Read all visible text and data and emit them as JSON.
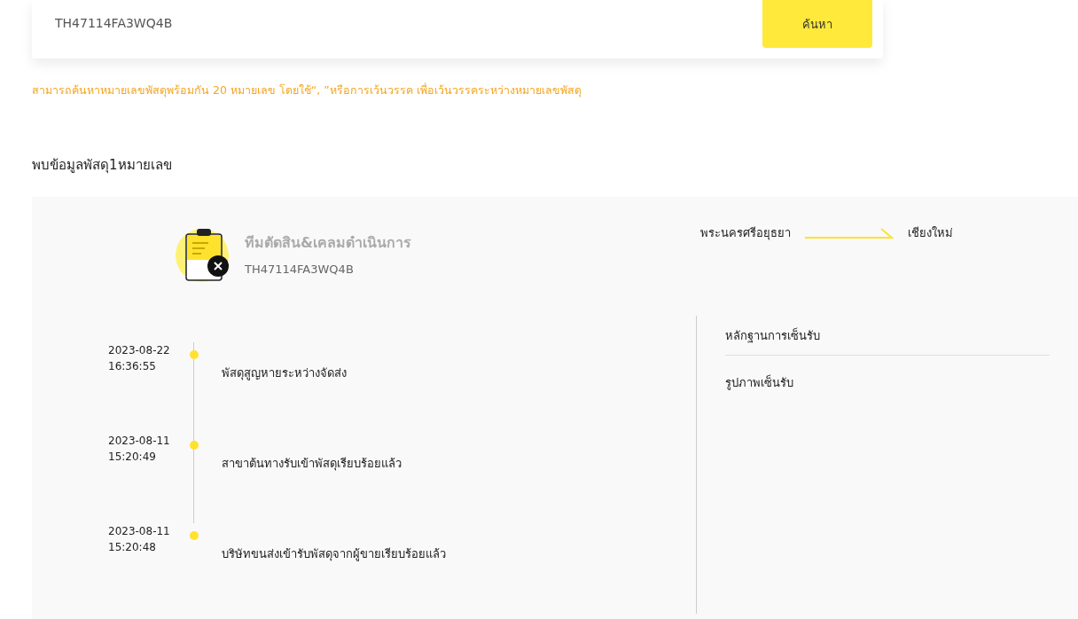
{
  "search": {
    "value": "TH47114FA3WQ4B",
    "button": "ค้นหา"
  },
  "hint": "สามารถค้นหาหมายเลขพัสดุพร้อมกัน 20 หมายเลข โดยใช้“, ”หรือการเว้นวรรค เพื่อเว้นวรรคระหว่างหมายเลขพัสดุ",
  "result_heading": "พบข้อมูลพัสดุ1หมายเลข",
  "parcel": {
    "status": "ทีมตัดสิน&เคลมดำเนินการ",
    "tracking_number": "TH47114FA3WQ4B",
    "origin": "พระนครศรีอยุธยา",
    "destination": "เชียงใหม่",
    "events": [
      {
        "date": "2023-08-22",
        "time": "16:36:55",
        "description": "พัสดุสูญหายระหว่างจัดส่ง"
      },
      {
        "date": "2023-08-11",
        "time": "15:20:49",
        "description": "สาขาต้นทางรับเข้าพัสดุเรียบร้อยแล้ว"
      },
      {
        "date": "2023-08-11",
        "time": "15:20:48",
        "description": "บริษัทขนส่งเข้ารับพัสดุจากผู้ขายเรียบร้อยแล้ว"
      }
    ],
    "proof_links": [
      "หลักฐานการเซ็นรับ",
      "รูปภาพเซ็นรับ"
    ]
  }
}
